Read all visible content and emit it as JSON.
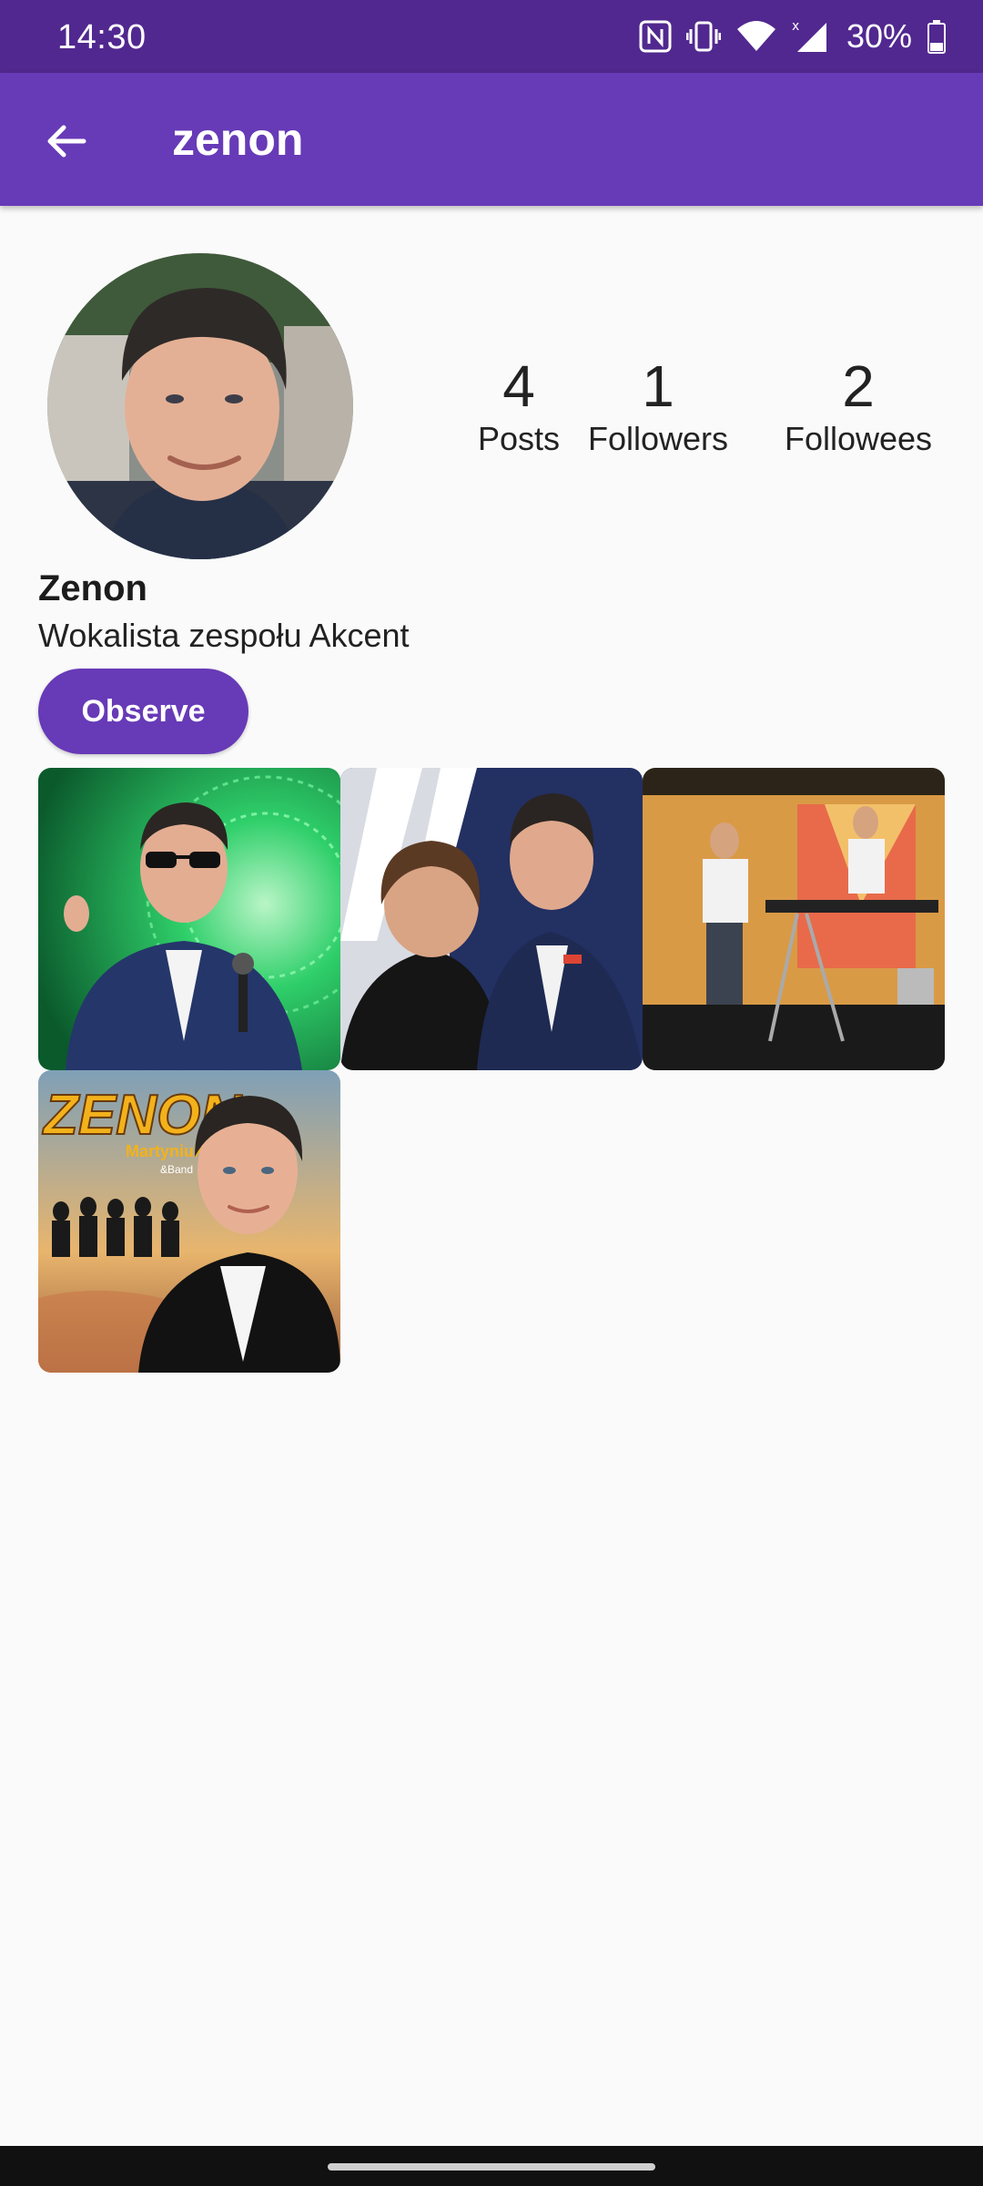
{
  "status_bar": {
    "time": "14:30",
    "battery": "30%",
    "icons": [
      "nfc-icon",
      "vibrate-icon",
      "wifi-icon",
      "signal-icon",
      "battery-icon"
    ]
  },
  "app_bar": {
    "title": "zenon",
    "back_icon": "arrow-back-icon"
  },
  "profile": {
    "name": "Zenon",
    "bio": "Wokalista zespołu Akcent",
    "observe_label": "Observe"
  },
  "stats": [
    {
      "value": "4",
      "label": "Posts"
    },
    {
      "value": "1",
      "label": "Followers"
    },
    {
      "value": "2",
      "label": "Followees"
    }
  ],
  "posts_thumb": {
    "poster_title": "ZENON",
    "poster_subtitle": "Martyniuk",
    "poster_band": "&Band"
  },
  "colors": {
    "primary": "#673ab7",
    "status_bar": "#51288f",
    "background": "#fafafa"
  }
}
